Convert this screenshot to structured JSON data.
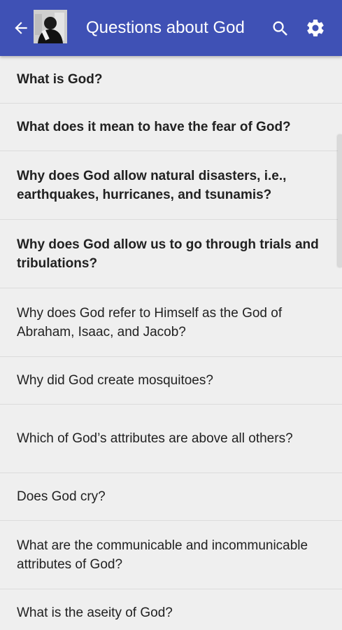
{
  "appbar": {
    "title": "Questions about God",
    "back_icon": "arrow-left-icon",
    "avatar_icon": "avatar-image",
    "search_icon": "search-icon",
    "settings_icon": "gear-icon",
    "background_color": "#3f51b5"
  },
  "questions": [
    {
      "label": "What is God?",
      "read": false
    },
    {
      "label": "What does it mean to have the fear of God?",
      "read": false
    },
    {
      "label": "Why does God allow natural disasters, i.e., earthquakes, hurricanes, and tsunamis?",
      "read": false
    },
    {
      "label": "Why does God allow us to go through trials and tribulations?",
      "read": false
    },
    {
      "label": "Why does God refer to Himself as the God of Abraham, Isaac, and Jacob?",
      "read": true
    },
    {
      "label": "Why did God create mosquitoes?",
      "read": true
    },
    {
      "label": "Which of God’s attributes are above all others?",
      "read": true
    },
    {
      "label": "Does God cry?",
      "read": true
    },
    {
      "label": "What are the communicable and incommunicable attributes of God?",
      "read": true
    },
    {
      "label": "What is the aseity of God?",
      "read": true
    }
  ]
}
